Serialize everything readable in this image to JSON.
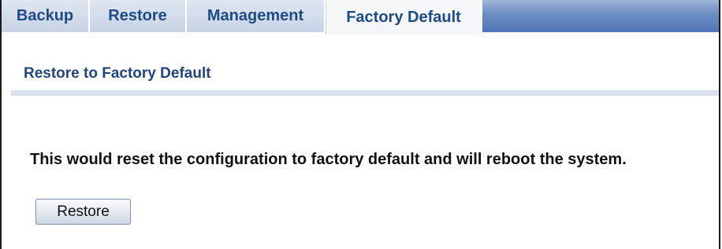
{
  "tabs": [
    {
      "label": "Backup",
      "active": false
    },
    {
      "label": "Restore",
      "active": false
    },
    {
      "label": "Management",
      "active": false
    },
    {
      "label": "Factory Default",
      "active": true
    }
  ],
  "section": {
    "title": "Restore to Factory Default",
    "message": "This would reset the configuration to factory default and will reboot the system.",
    "restore_button_label": "Restore"
  },
  "colors": {
    "tab_text": "#1e4b85",
    "section_title": "#23457a",
    "tabbar_accent": "#4f74b6"
  }
}
